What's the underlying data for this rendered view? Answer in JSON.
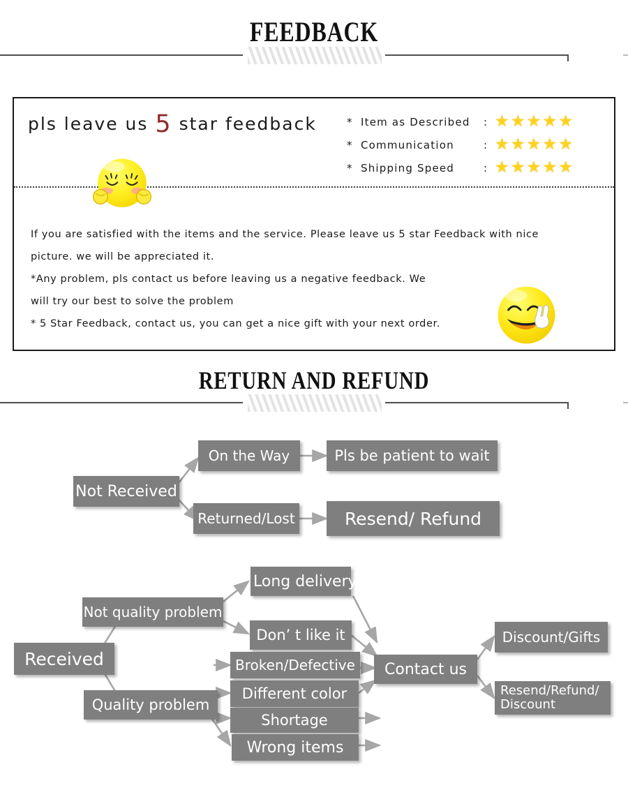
{
  "sections": {
    "feedback_heading": "FEEDBACK",
    "return_heading": "RETURN AND REFUND"
  },
  "feedback": {
    "headline_prefix": "pls leave us ",
    "headline_star_number": "5",
    "headline_suffix": " star feedback",
    "ratings": [
      {
        "mark": "*",
        "label": "Item as Described",
        "colon": ":",
        "stars": 5
      },
      {
        "mark": "*",
        "label": "Communication",
        "colon": ":",
        "stars": 5
      },
      {
        "mark": "*",
        "label": "Shipping Speed",
        "colon": ":",
        "stars": 5
      }
    ],
    "star_glyph": "★",
    "body_lines": [
      "If you are satisfied with the items and the service. Please leave us 5 star Feedback with nice",
      "picture. we will be appreciated it.",
      "*Any problem, pls contact us before leaving us a negative feedback. We",
      "will try our best to solve  the problem",
      "* 5 Star Feedback, contact us, you can get a nice gift with your next order."
    ],
    "emoji_shy_name": "blushing-closed-eyes-emoji",
    "emoji_peace_name": "smiling-peace-sign-emoji"
  },
  "flowchart": {
    "nodes": {
      "not_received": "Not Received",
      "on_the_way": "On the Way",
      "pls_be_patient": "Pls be patient to wait",
      "returned_lost": "Returned/Lost",
      "resend_refund": "Resend/ Refund",
      "received": "Received",
      "not_quality_problem": "Not quality problem",
      "long_delivery": "Long delivery",
      "dont_like_it": "Don’ t like it",
      "quality_problem": "Quality problem",
      "broken_defective": "Broken/Defective",
      "different_color": "Different color",
      "shortage": "Shortage",
      "wrong_items": "Wrong items",
      "contact_us": "Contact us",
      "discount_gifts": "Discount/Gifts",
      "resend_refund_discount_line1": "Resend/Refund/",
      "resend_refund_discount_line2": "Discount"
    }
  },
  "colors": {
    "node_fill": "#7f7f7f",
    "node_text": "#ffffff",
    "arrow": "#a6a6a6",
    "star": "#ffd21e",
    "accent_red": "#8e2b2b",
    "rule": "#4d4d4d"
  }
}
